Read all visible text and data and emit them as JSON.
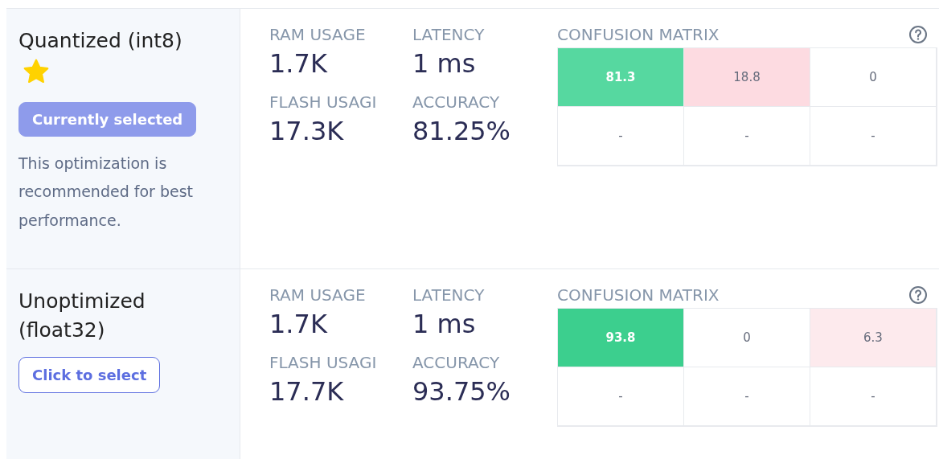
{
  "models": [
    {
      "title": "Quantized (int8)",
      "recommended": true,
      "selected": true,
      "button": "Currently selected",
      "note": "This optimization is recommended for best performance.",
      "metrics": [
        {
          "label": "RAM USAGE",
          "value": "1.7K"
        },
        {
          "label": "LATENCY",
          "value": "1 ms"
        },
        {
          "label": "FLASH USAGI",
          "value": "17.3K"
        },
        {
          "label": "ACCURACY",
          "value": "81.25%"
        }
      ],
      "matrix": {
        "title": "CONFUSION MATRIX",
        "rows": [
          [
            {
              "text": "81.3",
              "color": "#56d8a0"
            },
            {
              "text": "18.8",
              "color": "#fddbe1"
            },
            {
              "text": "0",
              "color": "#ffffff"
            }
          ],
          [
            {
              "text": "-",
              "color": "#ffffff"
            },
            {
              "text": "-",
              "color": "#ffffff"
            },
            {
              "text": "-",
              "color": "#ffffff"
            }
          ]
        ]
      }
    },
    {
      "title": "Unoptimized (float32)",
      "recommended": false,
      "selected": false,
      "button": "Click to select",
      "metrics": [
        {
          "label": "RAM USAGE",
          "value": "1.7K"
        },
        {
          "label": "LATENCY",
          "value": "1 ms"
        },
        {
          "label": "FLASH USAGI",
          "value": "17.7K"
        },
        {
          "label": "ACCURACY",
          "value": "93.75%"
        }
      ],
      "matrix": {
        "title": "CONFUSION MATRIX",
        "rows": [
          [
            {
              "text": "93.8",
              "color": "#3ccf8e"
            },
            {
              "text": "0",
              "color": "#ffffff"
            },
            {
              "text": "6.3",
              "color": "#fdeaed"
            }
          ],
          [
            {
              "text": "-",
              "color": "#ffffff"
            },
            {
              "text": "-",
              "color": "#ffffff"
            },
            {
              "text": "-",
              "color": "#ffffff"
            }
          ]
        ]
      }
    }
  ]
}
